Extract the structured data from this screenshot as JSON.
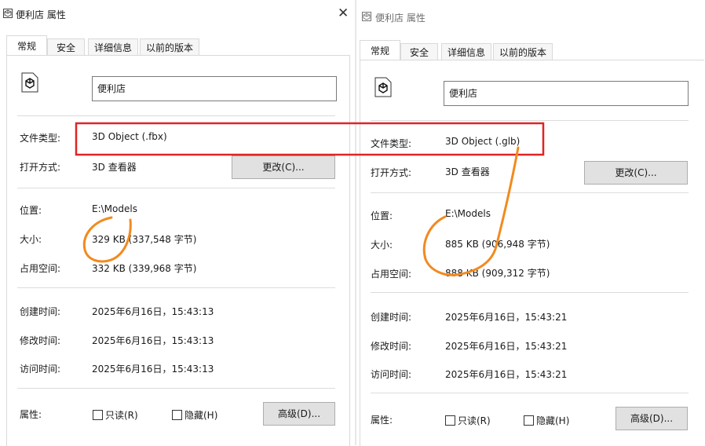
{
  "left": {
    "title": "便利店 属性",
    "close": "✕",
    "tabs": [
      "常规",
      "安全",
      "详细信息",
      "以前的版本"
    ],
    "file_name": "便利店",
    "type_label": "文件类型:",
    "type_value": "3D Object (.fbx)",
    "open_label": "打开方式:",
    "open_value": "3D 查看器",
    "change_button": "更改(C)...",
    "location_label": "位置:",
    "location_value": "E:\\Models",
    "size_label": "大小:",
    "size_value": "329 KB (337,548 字节)",
    "disk_label": "占用空间:",
    "disk_value": "332 KB (339,968 字节)",
    "created_label": "创建时间:",
    "created_value": "2025年6月16日，15:43:13",
    "modified_label": "修改时间:",
    "modified_value": "2025年6月16日，15:43:13",
    "accessed_label": "访问时间:",
    "accessed_value": "2025年6月16日，15:43:13",
    "attr_label": "属性:",
    "readonly": "只读(R)",
    "hidden": "隐藏(H)",
    "advanced_button": "高级(D)..."
  },
  "right": {
    "title": "便利店 属性",
    "tabs": [
      "常规",
      "安全",
      "详细信息",
      "以前的版本"
    ],
    "file_name": "便利店",
    "type_label": "文件类型:",
    "type_value": "3D Object (.glb)",
    "open_label": "打开方式:",
    "open_value": "3D 查看器",
    "change_button": "更改(C)...",
    "location_label": "位置:",
    "location_value": "E:\\Models",
    "size_label": "大小:",
    "size_value": "885 KB (906,948 字节)",
    "disk_label": "占用空间:",
    "disk_value": "888 KB (909,312 字节)",
    "created_label": "创建时间:",
    "created_value": "2025年6月16日，15:43:21",
    "modified_label": "修改时间:",
    "modified_value": "2025年6月16日，15:43:21",
    "accessed_label": "访问时间:",
    "accessed_value": "2025年6月16日，15:43:21",
    "attr_label": "属性:",
    "readonly": "只读(R)",
    "hidden": "隐藏(H)",
    "advanced_button": "高级(D)..."
  },
  "colors": {
    "annotation_red": "#e02424",
    "annotation_orange": "#f28a1f"
  }
}
